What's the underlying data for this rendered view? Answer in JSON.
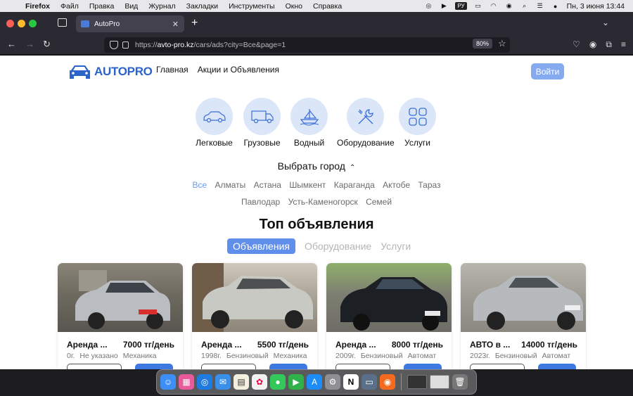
{
  "menubar": {
    "app": "Firefox",
    "items": [
      "Файл",
      "Правка",
      "Вид",
      "Журнал",
      "Закладки",
      "Инструменты",
      "Окно",
      "Справка"
    ],
    "lang": "РУ",
    "clock": "Пн, 3 июня  13:44"
  },
  "browser": {
    "tab_title": "AutoPro",
    "url_prefix": "https://",
    "url_host": "avto-pro.kz",
    "url_path": "/cars/ads?city=Все&page=1",
    "zoom": "80%"
  },
  "header": {
    "logo_text_a": "AUTO",
    "logo_text_b": "PRO",
    "nav": [
      "Главная",
      "Акции и Объявления"
    ],
    "login": "Войти"
  },
  "categories": [
    {
      "label": "Легковые",
      "icon": "car-icon"
    },
    {
      "label": "Грузовые",
      "icon": "truck-icon"
    },
    {
      "label": "Водный",
      "icon": "boat-icon"
    },
    {
      "label": "Оборудование",
      "icon": "tools-icon"
    },
    {
      "label": "Услуги",
      "icon": "grid-icon"
    }
  ],
  "city": {
    "title": "Выбрать город",
    "row1": [
      "Все",
      "Алматы",
      "Астана",
      "Шымкент",
      "Караганда",
      "Актобе",
      "Тараз"
    ],
    "row2": [
      "Павлодар",
      "Усть-Каменогорск",
      "Семей"
    ],
    "active": "Все"
  },
  "top": {
    "title": "Топ объявления",
    "tabs": [
      "Объявления",
      "Оборудование",
      "Услуги"
    ],
    "active_tab": "Объявления"
  },
  "cards": [
    {
      "title": "Аренда ...",
      "price": "7000 тг/день",
      "year": "0г.",
      "fuel": "Не указано",
      "gear": "Механика",
      "car_color": "#b9bcc0"
    },
    {
      "title": "Аренда ...",
      "price": "5500 тг/день",
      "year": "1998г.",
      "fuel": "Бензиновый",
      "gear": "Механика",
      "car_color": "#c9c9c4"
    },
    {
      "title": "Аренда ...",
      "price": "8000 тг/день",
      "year": "2009г.",
      "fuel": "Бензиновый",
      "gear": "Автомат",
      "car_color": "#1c1f24"
    },
    {
      "title": "АВТО в ...",
      "price": "14000 тг/день",
      "year": "2023г.",
      "fuel": "Бензиновый",
      "gear": "Автомат",
      "car_color": "#b7babd"
    }
  ],
  "colors": {
    "accent": "#5f8fea",
    "login": "#86aaf0",
    "logo": "#2a63c9",
    "category_bg": "#dbe6f8"
  }
}
